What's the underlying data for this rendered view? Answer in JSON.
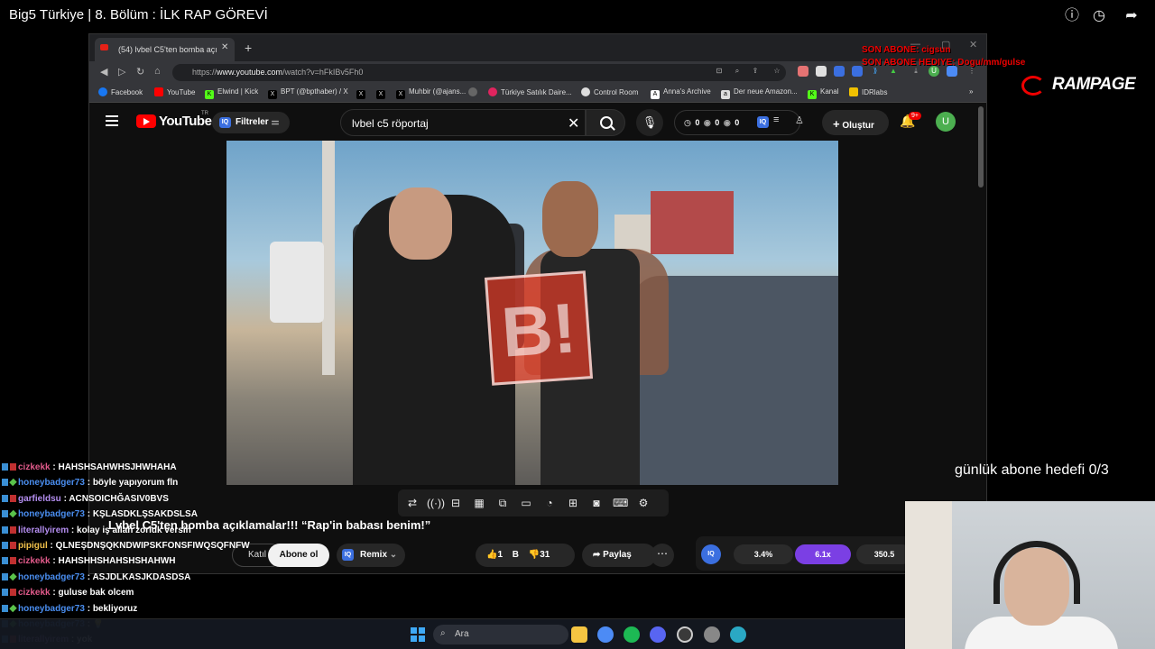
{
  "stream": {
    "title": "Big5 Türkiye | 8. Bölüm : İLK RAP GÖREVİ",
    "last_subscriber": "SON ABONE: cigsun",
    "last_gift": "SON ABONE HEDIYE: Dogu/mm/gulse",
    "brand": "RAMPAGE",
    "goal": "günlük abone hedefi 0/3"
  },
  "browser": {
    "tab_title": "(54) lvbel C5'ten bomba açı",
    "url_prefix": "https://",
    "url_host": "www.youtube.com",
    "url_path": "/watch?v=hFkIBv5Fh0",
    "bookmarks": [
      "Facebook",
      "YouTube",
      "Elwind | Kick",
      "BPT (@bpthaber) / X",
      "X",
      "X",
      "Muhbir (@ajans...",
      "Türkiye Satılık Daire...",
      "Control Room",
      "Anna's Archive",
      "Der neue Amazon...",
      "Kanal",
      "IDRlabs"
    ]
  },
  "youtube": {
    "logo": "YouTube",
    "country": "TR",
    "filters_label": "Filtreler",
    "search_value": "lvbel c5 röportaj",
    "stats": [
      "0",
      "0",
      "0"
    ],
    "create_label": "Oluştur",
    "notifications": "9+",
    "avatar_letter": "U"
  },
  "video": {
    "watermark": "B!",
    "title": "Lvbel C5'ten bomba açıklamalar!!! “Rap'in babası benim!”",
    "join_label": "Katıl",
    "subscribe_label": "Abone ol",
    "remix_label": "Remix",
    "likes": "1 B",
    "dislikes": "31",
    "share_label": "Paylaş",
    "metrics": [
      "3.4%",
      "6.1x",
      "350.5"
    ]
  },
  "chat": [
    {
      "user": "cizkekk",
      "msg": "HAHSHSAHWHSJHWHAHA",
      "color": "#e05a8a",
      "badge": "b2"
    },
    {
      "user": "honeybadger73",
      "msg": "böyle yapıyorum fln",
      "color": "#4a8ef0",
      "badge": "b3"
    },
    {
      "user": "garfieldsu",
      "msg": "ACNSOICHĞASIV0BVS",
      "color": "#b48ef0",
      "badge": "b2"
    },
    {
      "user": "honeybadger73",
      "msg": "KŞLASDKLŞSAKDSLSA",
      "color": "#4a8ef0",
      "badge": "b3"
    },
    {
      "user": "literallyirem",
      "msg": "kolay iş allah zorluk versin",
      "color": "#b48ef0",
      "badge": "b2"
    },
    {
      "user": "pipigul",
      "msg": "QLNEŞDNŞQKNDWIPSKFONSFIWQSQFNFW",
      "color": "#f0c04a",
      "badge": "b2"
    },
    {
      "user": "cizkekk",
      "msg": "HAHSHHSHAHSHSHAHWH",
      "color": "#e05a8a",
      "badge": "b2"
    },
    {
      "user": "honeybadger73",
      "msg": "ASJDLKASJKDASDSA",
      "color": "#4a8ef0",
      "badge": "b3"
    },
    {
      "user": "cizkekk",
      "msg": "guluse bak olcem",
      "color": "#e05a8a",
      "badge": "b2"
    },
    {
      "user": "honeybadger73",
      "msg": "bekliyoruz",
      "color": "#4a8ef0",
      "badge": "b3"
    },
    {
      "user": "honeybadger73",
      "msg": "💡",
      "color": "#4a8ef0",
      "badge": "b3"
    },
    {
      "user": "literallyirem",
      "msg": "yok",
      "color": "#b48ef0",
      "badge": "b2"
    }
  ],
  "taskbar": {
    "search_placeholder": "Ara"
  }
}
